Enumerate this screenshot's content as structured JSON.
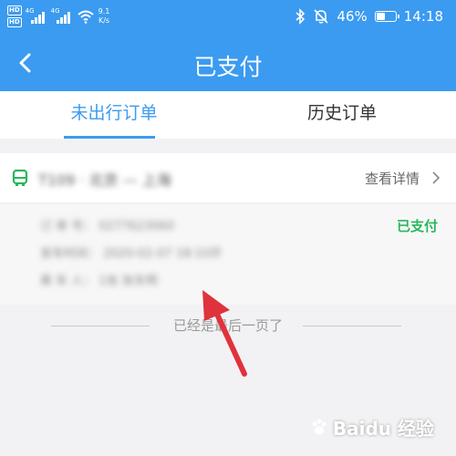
{
  "status_bar": {
    "sim1": "HD",
    "sim2": "HD",
    "net1": "4G",
    "net2": "4G",
    "speed_value": "9.1",
    "speed_unit": "K/s",
    "battery_text": "46%",
    "battery_level": 0.46,
    "time": "14:18"
  },
  "header": {
    "title": "已支付",
    "back_icon": "chevron-left-icon"
  },
  "tabs": [
    {
      "label": "未出行订单",
      "active": true
    },
    {
      "label": "历史订单",
      "active": false
    }
  ],
  "order": {
    "icon": "bus-icon",
    "route": "T109 · 北京 — 上海",
    "detail_label": "查看详情",
    "status": "已支付",
    "fields": [
      {
        "text": "订 单 号：  0277623060"
      },
      {
        "text": "发车时间：  2020-02-07   18:10开"
      },
      {
        "text": "乘 车 人：  1张   张东明"
      }
    ]
  },
  "list_end": {
    "text": "已经是最后一页了"
  },
  "watermark": {
    "text": "Baidu 经验"
  },
  "colors": {
    "brand": "#3b9bf0",
    "paid": "#27b85a",
    "arrow": "#e0323c"
  }
}
